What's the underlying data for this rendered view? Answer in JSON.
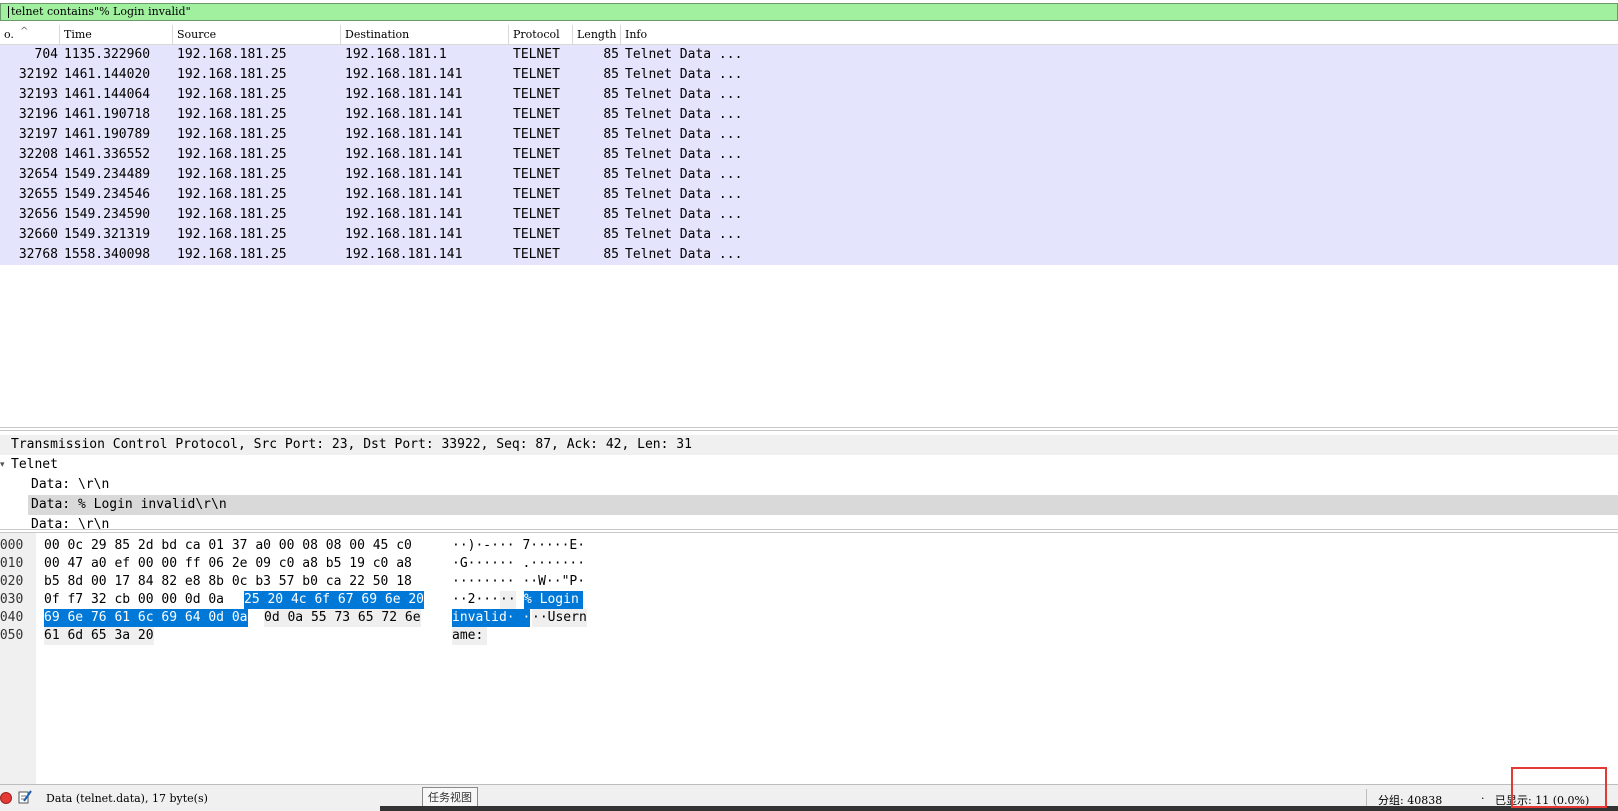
{
  "filter": {
    "value": "telnet contains\"% Login invalid\""
  },
  "columns": {
    "no": "o.",
    "time": "Time",
    "source": "Source",
    "destination": "Destination",
    "protocol": "Protocol",
    "length": "Length",
    "info": "Info"
  },
  "packets": [
    {
      "no": "704",
      "time": "1135.322960",
      "src": "192.168.181.25",
      "dst": "192.168.181.1",
      "proto": "TELNET",
      "len": "85",
      "info": "Telnet Data ..."
    },
    {
      "no": "32192",
      "time": "1461.144020",
      "src": "192.168.181.25",
      "dst": "192.168.181.141",
      "proto": "TELNET",
      "len": "85",
      "info": "Telnet Data ..."
    },
    {
      "no": "32193",
      "time": "1461.144064",
      "src": "192.168.181.25",
      "dst": "192.168.181.141",
      "proto": "TELNET",
      "len": "85",
      "info": "Telnet Data ..."
    },
    {
      "no": "32196",
      "time": "1461.190718",
      "src": "192.168.181.25",
      "dst": "192.168.181.141",
      "proto": "TELNET",
      "len": "85",
      "info": "Telnet Data ..."
    },
    {
      "no": "32197",
      "time": "1461.190789",
      "src": "192.168.181.25",
      "dst": "192.168.181.141",
      "proto": "TELNET",
      "len": "85",
      "info": "Telnet Data ..."
    },
    {
      "no": "32208",
      "time": "1461.336552",
      "src": "192.168.181.25",
      "dst": "192.168.181.141",
      "proto": "TELNET",
      "len": "85",
      "info": "Telnet Data ..."
    },
    {
      "no": "32654",
      "time": "1549.234489",
      "src": "192.168.181.25",
      "dst": "192.168.181.141",
      "proto": "TELNET",
      "len": "85",
      "info": "Telnet Data ..."
    },
    {
      "no": "32655",
      "time": "1549.234546",
      "src": "192.168.181.25",
      "dst": "192.168.181.141",
      "proto": "TELNET",
      "len": "85",
      "info": "Telnet Data ..."
    },
    {
      "no": "32656",
      "time": "1549.234590",
      "src": "192.168.181.25",
      "dst": "192.168.181.141",
      "proto": "TELNET",
      "len": "85",
      "info": "Telnet Data ..."
    },
    {
      "no": "32660",
      "time": "1549.321319",
      "src": "192.168.181.25",
      "dst": "192.168.181.141",
      "proto": "TELNET",
      "len": "85",
      "info": "Telnet Data ..."
    },
    {
      "no": "32768",
      "time": "1558.340098",
      "src": "192.168.181.25",
      "dst": "192.168.181.141",
      "proto": "TELNET",
      "len": "85",
      "info": "Telnet Data ..."
    }
  ],
  "details": {
    "tcp": "Transmission Control Protocol, Src Port: 23, Dst Port: 33922, Seq: 87, Ack: 42, Len: 31",
    "telnet": "Telnet",
    "data1": "Data: \\r\\n",
    "data2": "Data: % Login invalid\\r\\n",
    "data3": "Data: \\r\\n"
  },
  "bytes": {
    "offsets": [
      "0000",
      "0010",
      "0020",
      "0030",
      "0040",
      "0050"
    ],
    "r0_hex": "00 0c 29 85 2d bd ca 01  37 a0 00 08 08 00 45 c0",
    "r0_ascii": "··)·-··· 7·····E·",
    "r1_hex": "00 47 a0 ef 00 00 ff 06  2e 09 c0 a8 b5 19 c0 a8",
    "r1_ascii": "·G······ .·······",
    "r2_hex": "b5 8d 00 17 84 82 e8 8b  0c b3 57 b0 ca 22 50 18",
    "r2_ascii": "········ ··W··\"P·",
    "r3_hex_a": "0f f7 32 cb 00 00 0d 0a",
    "r3_hex_b": "25 20 4c 6f 67 69 6e 20",
    "r3_ascii_a": "··2···",
    "r3_ascii_b": "··",
    "r3_ascii_c": "% Login",
    "r4_hex_a": "69 6e 76 61 6c 69 64 0d  0a",
    "r4_hex_b": "0d 0a 55 73 65 72 6e",
    "r4_ascii_a": "invalid· ·",
    "r4_ascii_b": "··Usern",
    "r5_hex": "61 6d 65 3a 20",
    "r5_ascii": "ame:"
  },
  "status": {
    "field_info": "Data (telnet.data), 17 byte(s)",
    "tooltip": "任务视图",
    "packets": "分组: 40838",
    "separator": "·",
    "displayed_label": "已显示:",
    "displayed_value": "11 (0.0%)"
  },
  "colors": {
    "filter_ok": "#a0f0a0",
    "row_telnet": "#e4e4fc",
    "selection": "#0078d7",
    "annotation": "#e53935"
  }
}
